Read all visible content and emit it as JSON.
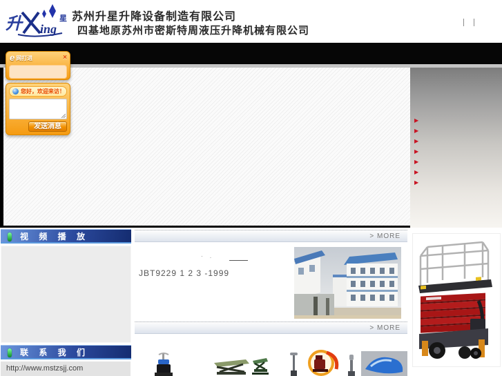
{
  "header": {
    "logo": {
      "glyph_sheng": "升",
      "glyph_x": "X",
      "glyph_ing": "ing",
      "glyph_xing": "星"
    },
    "company_line1": "苏州升星升降设备制造有限公司",
    "company_line2": "四基地原苏州市密斯特周液压升降机械有限公司"
  },
  "chat": {
    "logo_letter": "e",
    "title": "网打进",
    "close_label": "×",
    "greeting": "您好，欢迎来访！",
    "message_value": "",
    "send_button": "发送消息"
  },
  "banner": {
    "menu_item_count": 7
  },
  "icons": {
    "menu_arrow_icon": "▶"
  },
  "left_column": {
    "video_title": "视 频 播 放",
    "contact_title": "联 系 我 们",
    "site_url": "http://www.mstzsjj.com"
  },
  "news": {
    "more_label": "> MORE",
    "fragment_marks": "· .",
    "item_text": "JBT9229 1 2 3 -1999"
  },
  "products": {
    "more_label": "> MORE"
  },
  "colors": {
    "accent_blue": "#24418f",
    "accent_orange": "#f59b12",
    "arrow_red": "#c81423",
    "lift_red": "#a81616"
  }
}
